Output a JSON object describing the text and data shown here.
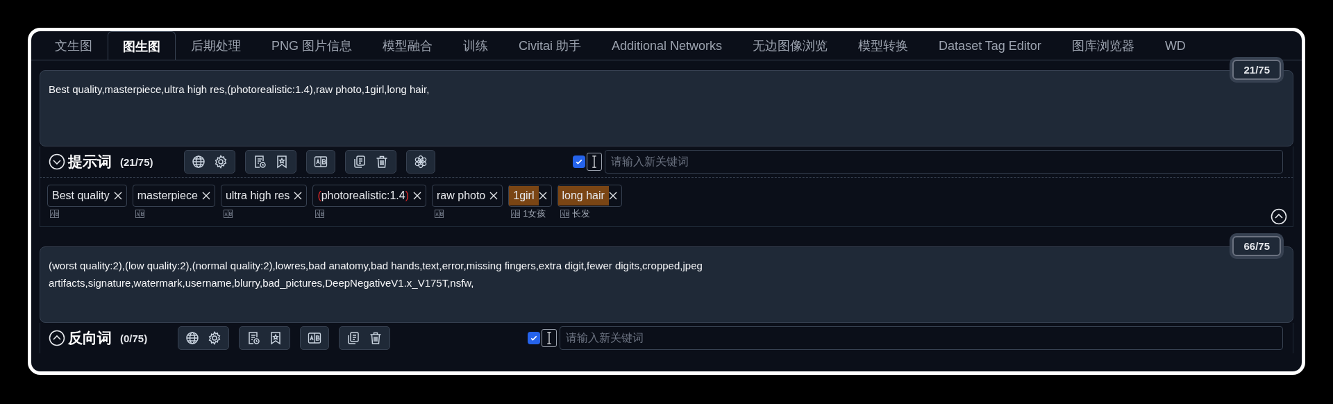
{
  "tabs": [
    {
      "label": "文生图",
      "selected": false
    },
    {
      "label": "图生图",
      "selected": true
    },
    {
      "label": "后期处理",
      "selected": false
    },
    {
      "label": "PNG 图片信息",
      "selected": false
    },
    {
      "label": "模型融合",
      "selected": false
    },
    {
      "label": "训练",
      "selected": false
    },
    {
      "label": "Civitai 助手",
      "selected": false
    },
    {
      "label": "Additional Networks",
      "selected": false
    },
    {
      "label": "无边图像浏览",
      "selected": false
    },
    {
      "label": "模型转换",
      "selected": false
    },
    {
      "label": "Dataset Tag Editor",
      "selected": false
    },
    {
      "label": "图库浏览器",
      "selected": false
    },
    {
      "label": "WD",
      "selected": false
    }
  ],
  "sections": [
    {
      "counter": "21/75",
      "text": "Best quality,masterpiece,ultra high res,(photorealistic:1.4),raw photo,1girl,long hair,",
      "title": "提示词",
      "count": "(21/75)",
      "expanded": true,
      "toolbar": [
        {
          "kind": "translate"
        },
        {
          "kind": "history"
        },
        {
          "kind": "swap"
        },
        {
          "kind": "edit"
        },
        {
          "kind": "assistant"
        }
      ],
      "autocomplete_checked": true,
      "placeholder": "请输入新关键词",
      "tags": [
        {
          "text": "Best quality",
          "highlighted": false
        },
        {
          "text": "masterpiece",
          "highlighted": false
        },
        {
          "text": "ultra high res",
          "highlighted": false
        },
        {
          "prefix": "(",
          "text": "photorealistic:1.4",
          "suffix": ")",
          "highlighted": false
        },
        {
          "text": "raw photo",
          "highlighted": false
        },
        {
          "text": "1girl",
          "highlighted": true,
          "translation": "1女孩"
        },
        {
          "text": "long hair",
          "highlighted": true,
          "translation": "长发"
        }
      ]
    },
    {
      "counter": "66/75",
      "text": "(worst quality:2),(low quality:2),(normal quality:2),lowres,bad anatomy,bad hands,text,error,missing fingers,extra digit,fewer digits,cropped,jpeg artifacts,signature,watermark,username,blurry,bad_pictures,DeepNegativeV1.x_V175T,nsfw,",
      "title": "反向词",
      "count": "(0/75)",
      "expanded": false,
      "toolbar": [
        {
          "kind": "translate"
        },
        {
          "kind": "history"
        },
        {
          "kind": "swap"
        },
        {
          "kind": "edit"
        }
      ],
      "autocomplete_checked": true,
      "placeholder": "请输入新关键词"
    }
  ]
}
